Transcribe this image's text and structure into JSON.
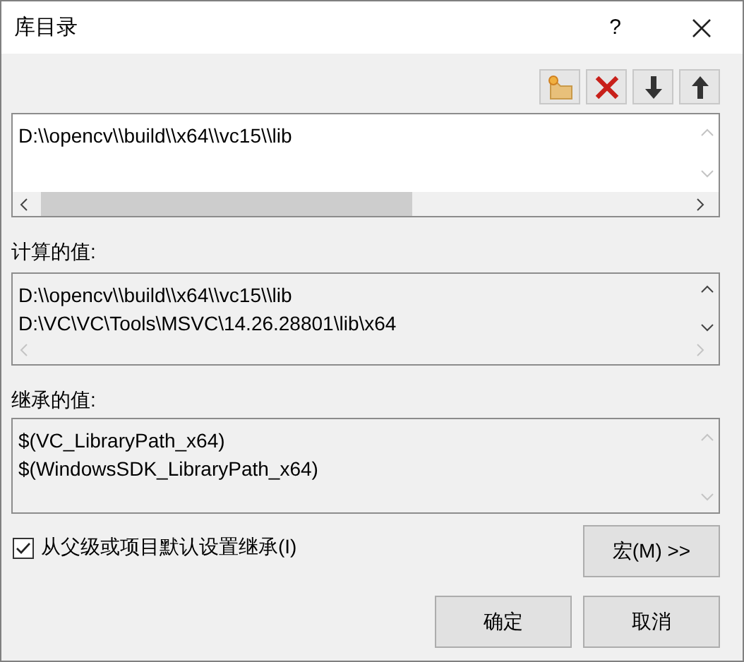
{
  "window": {
    "title": "库目录",
    "help": "?"
  },
  "toolbar": [
    {
      "kind": "new-folder"
    },
    {
      "kind": "delete"
    },
    {
      "kind": "move-down"
    },
    {
      "kind": "move-up"
    }
  ],
  "editor": {
    "lines": [
      "D:\\\\opencv\\\\build\\\\x64\\\\vc15\\\\lib"
    ]
  },
  "computed": {
    "label": "计算的值:",
    "lines": [
      "D:\\\\opencv\\\\build\\\\x64\\\\vc15\\\\lib",
      "D:\\VC\\VC\\Tools\\MSVC\\14.26.28801\\lib\\x64"
    ]
  },
  "inherited": {
    "label": "继承的值:",
    "lines": [
      "$(VC_LibraryPath_x64)",
      "$(WindowsSDK_LibraryPath_x64)"
    ]
  },
  "inherit_checkbox": {
    "label": "从父级或项目默认设置继承(I)",
    "checked": true
  },
  "buttons": {
    "macros": "宏(M) >>",
    "ok": "确定",
    "cancel": "取消"
  }
}
